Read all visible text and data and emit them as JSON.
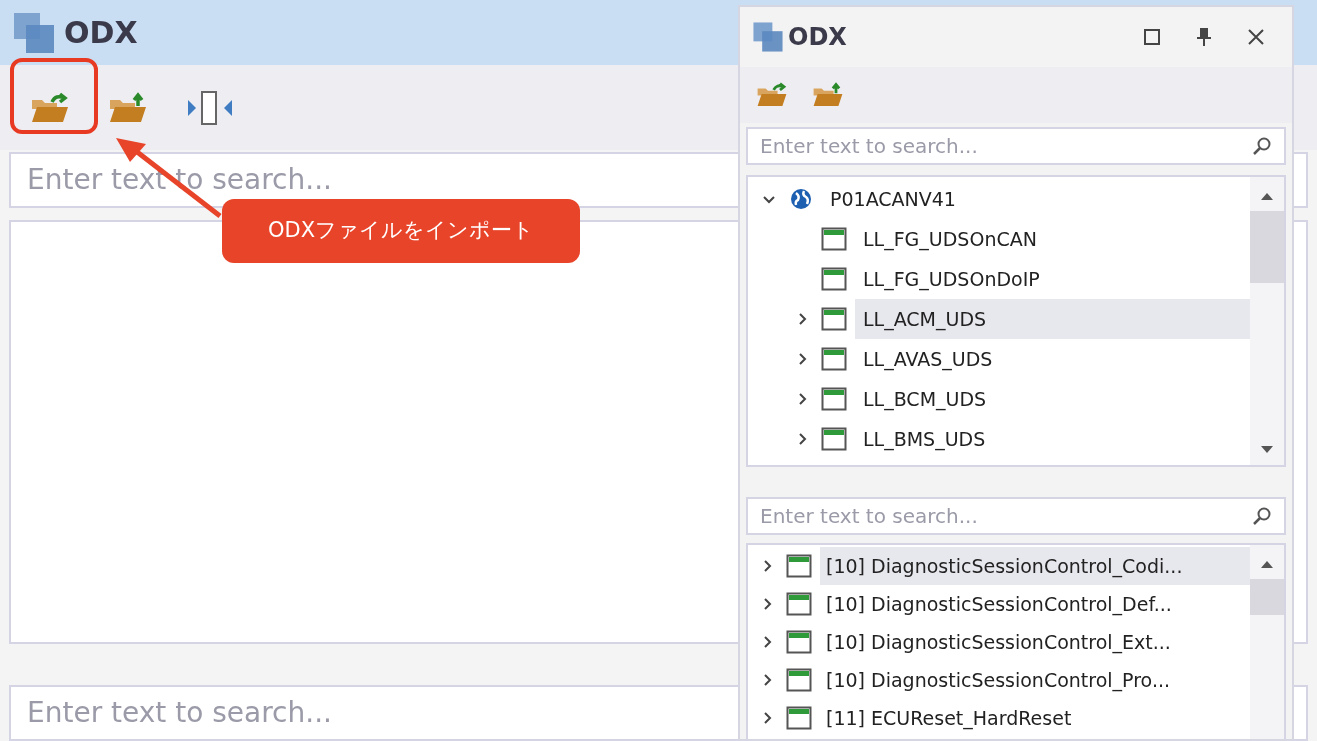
{
  "main": {
    "title": "ODX",
    "search_top": {
      "placeholder": "Enter text to search..."
    },
    "search_bottom": {
      "placeholder": "Enter text to search..."
    }
  },
  "callout": {
    "text": "ODXファイルをインポート"
  },
  "panel": {
    "title": "ODX",
    "tree_search": {
      "placeholder": "Enter text to search..."
    },
    "tree": [
      {
        "label": "P01ACANV41",
        "kind": "project",
        "expandable": true,
        "expanded": true,
        "selected": false,
        "children": [
          {
            "label": "LL_FG_UDSOnCAN",
            "kind": "layer",
            "expandable": false,
            "expanded": false,
            "selected": false
          },
          {
            "label": "LL_FG_UDSOnDoIP",
            "kind": "layer",
            "expandable": false,
            "expanded": false,
            "selected": false
          },
          {
            "label": "LL_ACM_UDS",
            "kind": "layer",
            "expandable": true,
            "expanded": false,
            "selected": true
          },
          {
            "label": "LL_AVAS_UDS",
            "kind": "layer",
            "expandable": true,
            "expanded": false,
            "selected": false
          },
          {
            "label": "LL_BCM_UDS",
            "kind": "layer",
            "expandable": true,
            "expanded": false,
            "selected": false
          },
          {
            "label": "LL_BMS_UDS",
            "kind": "layer",
            "expandable": true,
            "expanded": false,
            "selected": false
          }
        ]
      }
    ],
    "service_search": {
      "placeholder": "Enter text to search..."
    },
    "services": [
      {
        "label": "[10] DiagnosticSessionControl_Codi...",
        "selected": true
      },
      {
        "label": "[10] DiagnosticSessionControl_Def...",
        "selected": false
      },
      {
        "label": "[10] DiagnosticSessionControl_Ext...",
        "selected": false
      },
      {
        "label": "[10] DiagnosticSessionControl_Pro...",
        "selected": false
      },
      {
        "label": "[11] ECUReset_HardReset",
        "selected": false
      }
    ]
  }
}
